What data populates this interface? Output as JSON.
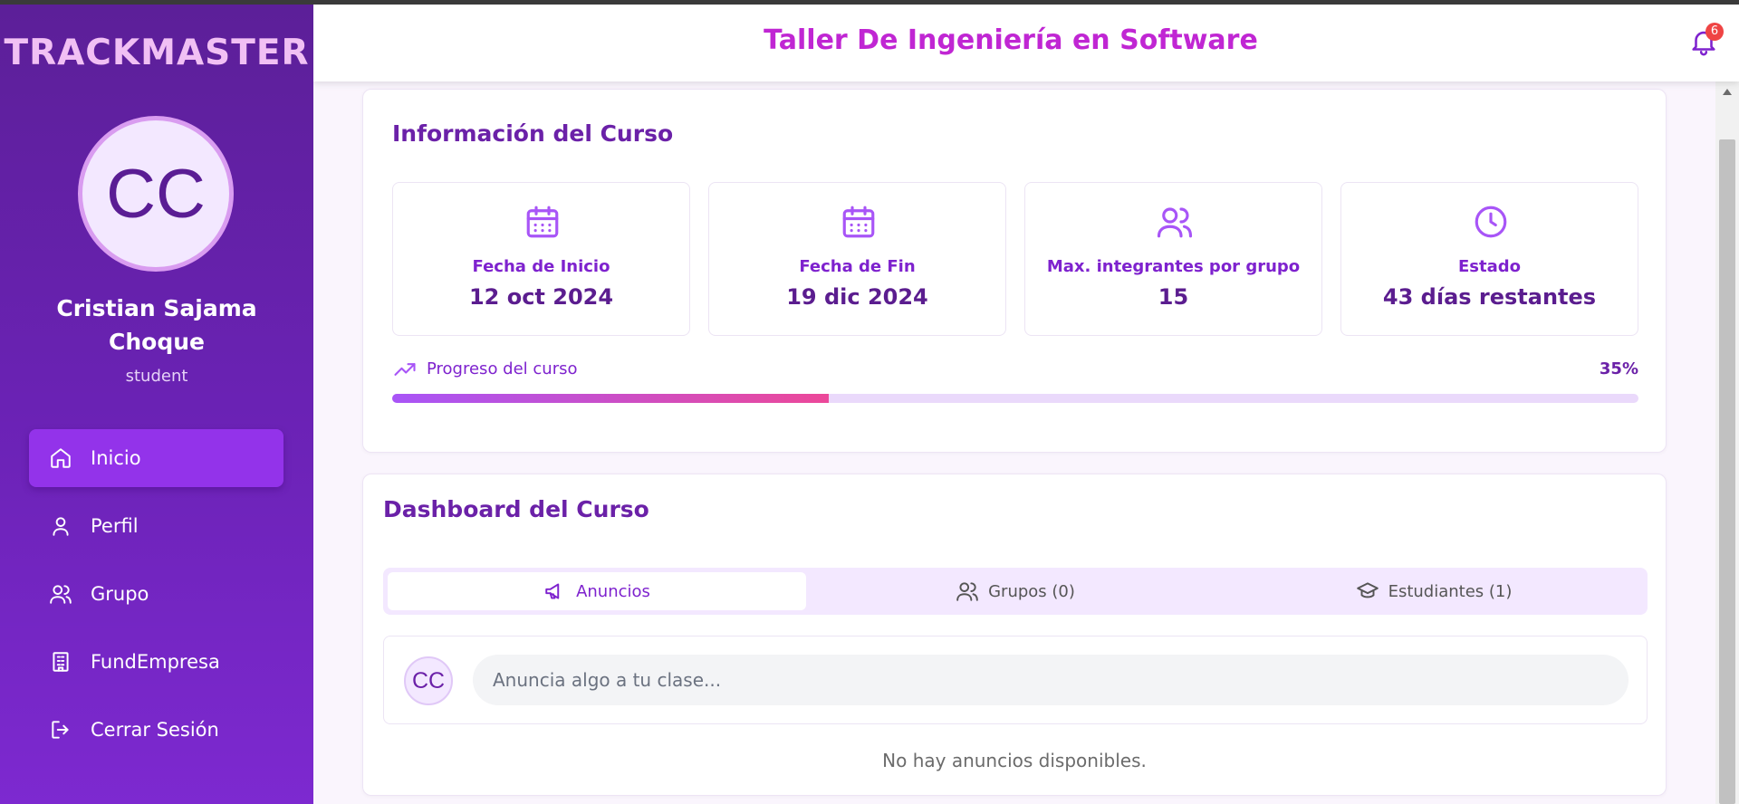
{
  "brand": "TRACKMASTER",
  "user": {
    "initials": "CC",
    "name": "Cristian Sajama Choque",
    "role": "student"
  },
  "nav": [
    {
      "label": "Inicio",
      "icon": "home-icon",
      "active": true
    },
    {
      "label": "Perfil",
      "icon": "user-icon",
      "active": false
    },
    {
      "label": "Grupo",
      "icon": "users-icon",
      "active": false
    },
    {
      "label": "FundEmpresa",
      "icon": "building-icon",
      "active": false
    },
    {
      "label": "Cerrar Sesión",
      "icon": "logout-icon",
      "active": false
    }
  ],
  "header": {
    "title": "Taller De Ingeniería en Software",
    "notification_count": "6"
  },
  "course_info": {
    "title": "Información del Curso",
    "stats": [
      {
        "label": "Fecha de Inicio",
        "value": "12 oct 2024",
        "icon": "calendar-icon"
      },
      {
        "label": "Fecha de Fin",
        "value": "19 dic 2024",
        "icon": "calendar-icon"
      },
      {
        "label": "Max. integrantes por grupo",
        "value": "15",
        "icon": "users-icon"
      },
      {
        "label": "Estado",
        "value": "43 días restantes",
        "icon": "clock-icon"
      }
    ],
    "progress": {
      "label": "Progreso del curso",
      "percent_text": "35%",
      "value": 35
    }
  },
  "dashboard": {
    "title": "Dashboard del Curso",
    "tabs": [
      {
        "label": "Anuncios",
        "icon": "megaphone-icon",
        "active": true
      },
      {
        "label": "Grupos (0)",
        "icon": "users-icon",
        "active": false
      },
      {
        "label": "Estudiantes (1)",
        "icon": "graduation-cap-icon",
        "active": false
      }
    ],
    "composer": {
      "initials": "CC",
      "placeholder": "Anuncia algo a tu clase..."
    },
    "empty_message": "No hay anuncios disponibles."
  },
  "colors": {
    "accent": "#9333ea",
    "title": "#c026d3",
    "badge": "#ef4444"
  }
}
